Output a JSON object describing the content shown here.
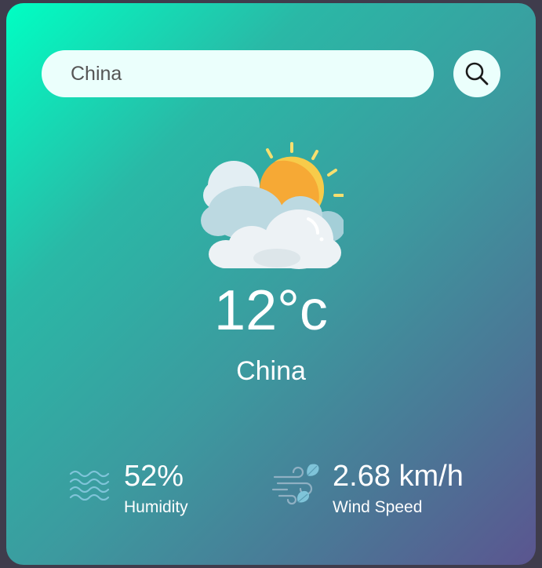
{
  "search": {
    "value": "China"
  },
  "weather": {
    "icon": "partly-cloudy-sun-icon",
    "temperature": "12°c",
    "city": "China"
  },
  "stats": {
    "humidity": {
      "icon": "humidity-waves-icon",
      "value": "52%",
      "label": "Humidity"
    },
    "wind": {
      "icon": "wind-icon",
      "value": "2.68 km/h",
      "label": "Wind Speed"
    }
  },
  "colors": {
    "gradient_start": "#00ffc3",
    "gradient_end": "#5b5590",
    "search_background": "#ebfffc",
    "text": "#ffffff"
  }
}
